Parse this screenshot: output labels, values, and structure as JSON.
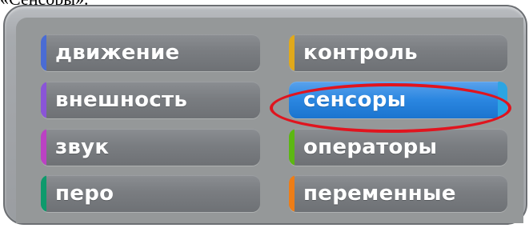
{
  "caption": "«Сенсоры».",
  "categories": [
    {
      "label": "движение",
      "color": "#4a6cd4",
      "selected": false
    },
    {
      "label": "контроль",
      "color": "#e1a91a",
      "selected": false
    },
    {
      "label": "внешность",
      "color": "#8a55d7",
      "selected": false
    },
    {
      "label": "сенсоры",
      "color": "#2ca5e2",
      "selected": true
    },
    {
      "label": "звук",
      "color": "#bb42c3",
      "selected": false
    },
    {
      "label": "операторы",
      "color": "#5cb712",
      "selected": false
    },
    {
      "label": "перо",
      "color": "#0e9a6c",
      "selected": false
    },
    {
      "label": "переменные",
      "color": "#ee7d16",
      "selected": false
    }
  ],
  "highlight_color": "#e0141e"
}
